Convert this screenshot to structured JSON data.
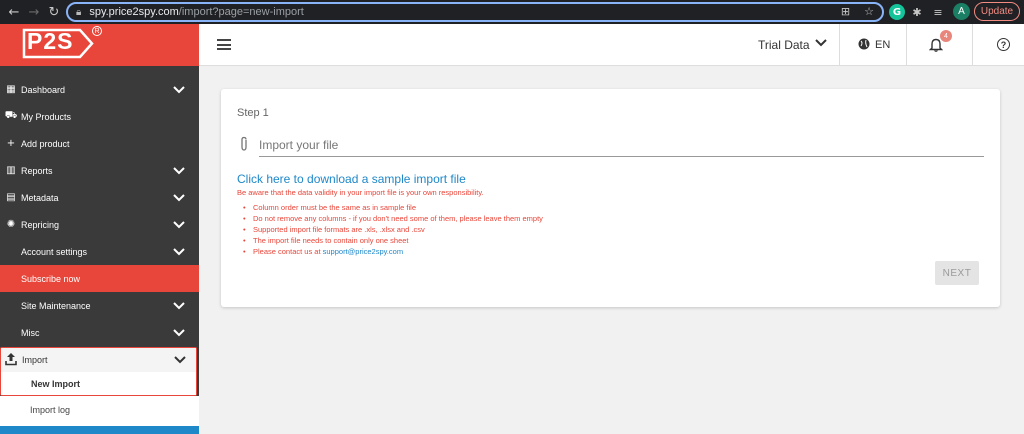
{
  "browser": {
    "url_host": "spy.price2spy.com",
    "url_path": "/import?page=new-import",
    "avatar_letter": "A",
    "grammarly_letter": "G",
    "update_label": "Update"
  },
  "header": {
    "logo_text": "P2S",
    "logo_reg": "R",
    "trial_label": "Trial Data",
    "language": "EN",
    "notification_count": "4",
    "help_glyph": "?"
  },
  "sidebar": {
    "items": [
      {
        "label": "Dashboard",
        "icon": "dashboard-icon"
      },
      {
        "label": "My Products",
        "icon": "basket-icon"
      },
      {
        "label": "Add product",
        "icon": "plus-icon"
      },
      {
        "label": "Reports",
        "icon": "bar-chart-icon"
      },
      {
        "label": "Metadata",
        "icon": "table-icon"
      },
      {
        "label": "Repricing",
        "icon": "lightbulb-icon"
      },
      {
        "label": "Account settings"
      },
      {
        "label": "Subscribe now"
      },
      {
        "label": "Site Maintenance"
      },
      {
        "label": "Misc"
      }
    ],
    "import_label": "Import",
    "new_import_label": "New Import",
    "import_log_label": "Import log"
  },
  "card": {
    "step_label": "Step 1",
    "file_placeholder": "Import your file",
    "download_link": "Click here to download a sample import file",
    "warning": "Be aware that the data validity in your import file is your own responsibility.",
    "rules": [
      "Column order must be the same as in sample file",
      "Do not remove any columns - if you don't need some of them, please leave them empty",
      "Supported import file formats are .xls, .xlsx and .csv",
      "The import file needs to contain only one sheet"
    ],
    "contact_prefix": "Please contact us at",
    "contact_email": "support@price2spy.com",
    "next_label": "NEXT"
  },
  "colors": {
    "brand_red": "#e8463a",
    "sidebar_bg": "#3a3a3a",
    "link_blue": "#1e88c9"
  }
}
